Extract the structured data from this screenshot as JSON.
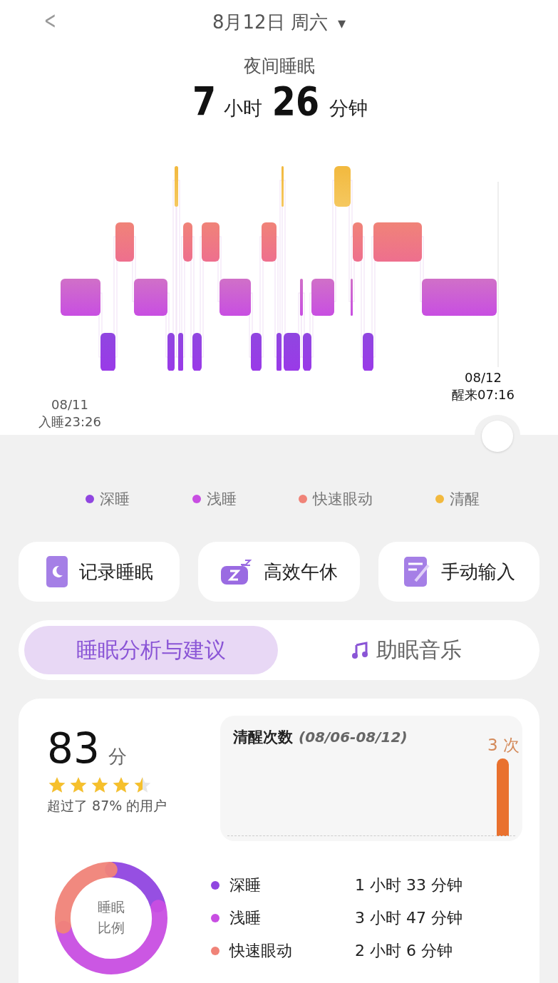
{
  "header": {
    "back": "<",
    "date": "8月12日 周六",
    "dropdown": "▾"
  },
  "summary": {
    "label": "夜间睡眠",
    "hours": "7",
    "hours_unit": "小时",
    "minutes": "26",
    "minutes_unit": "分钟"
  },
  "hypnogram": {
    "start_date": "08/11",
    "start_time": "入睡23:26",
    "end_date": "08/12",
    "end_time": "醒来07:16"
  },
  "legend": [
    {
      "label": "深睡",
      "color": "#9046e0"
    },
    {
      "label": "浅睡",
      "color": "#c84ee2"
    },
    {
      "label": "快速眼动",
      "color": "#f08378"
    },
    {
      "label": "清醒",
      "color": "#f2b93e"
    }
  ],
  "actions": [
    {
      "label": "记录睡眠",
      "kind": "phone"
    },
    {
      "label": "高效午休",
      "kind": "pillow"
    },
    {
      "label": "手动输入",
      "kind": "note"
    }
  ],
  "tabs": [
    {
      "label": "睡眠分析与建议",
      "selected": true,
      "kind": "text"
    },
    {
      "label": "助眠音乐",
      "selected": false,
      "kind": "music"
    }
  ],
  "score": {
    "value": "83",
    "unit": "分",
    "stars": 4.5,
    "note": "超过了 87% 的用户"
  },
  "awake_chart": {
    "title": "清醒次数",
    "range": "(08/06-08/12)",
    "reading": "3 次"
  },
  "ratio": {
    "center": "睡眠比例",
    "rows": [
      {
        "label": "深睡",
        "color": "#9046e0",
        "duration": "1 小时 33 分钟"
      },
      {
        "label": "浅睡",
        "color": "#c84ee2",
        "duration": "3 小时 47 分钟"
      },
      {
        "label": "快速眼动",
        "color": "#f08378",
        "duration": "2 小时 6 分钟"
      }
    ]
  }
}
